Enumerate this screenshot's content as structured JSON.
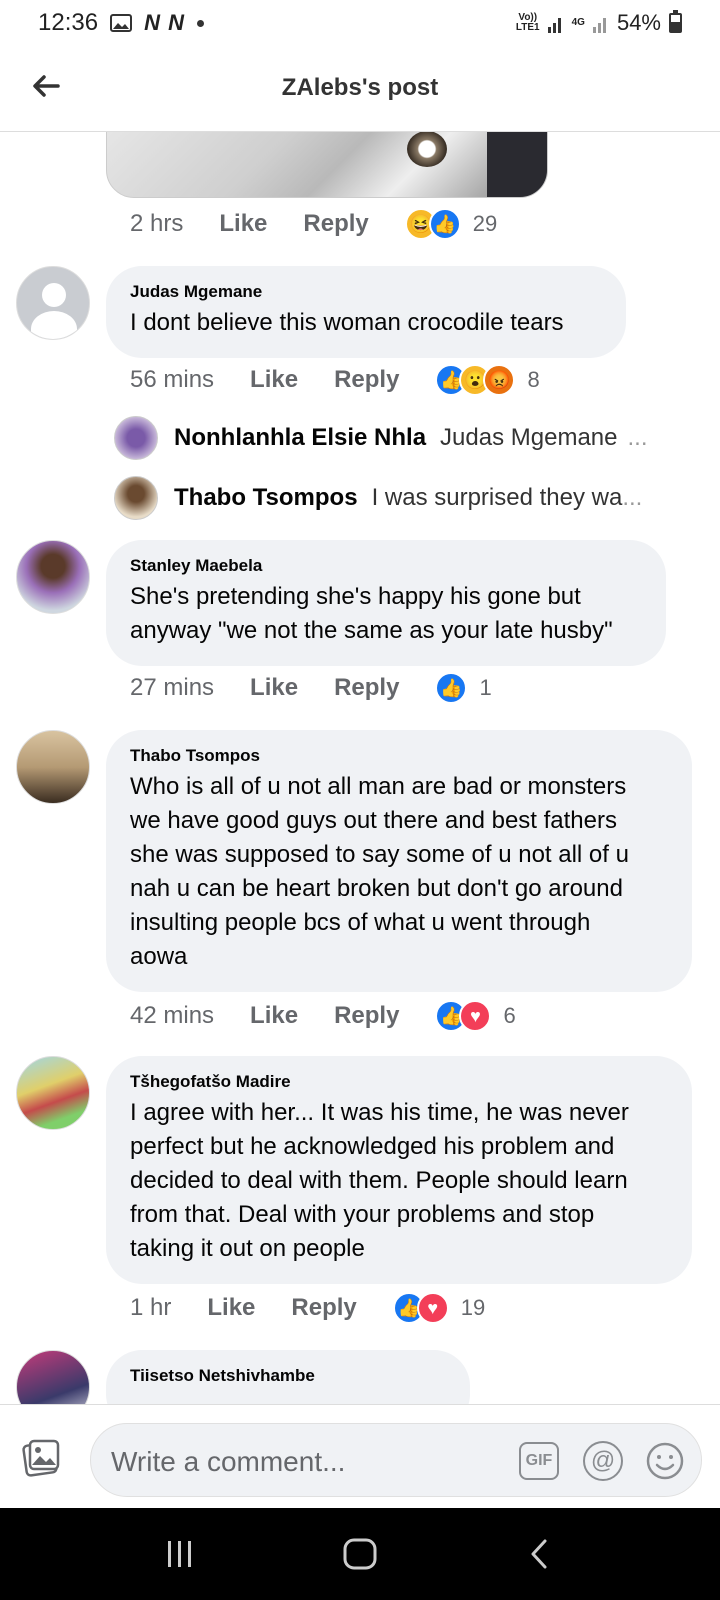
{
  "status_bar": {
    "time": "12:36",
    "notif_icons": [
      "image-icon",
      "news-icon",
      "news-icon"
    ],
    "nn_label": "N N",
    "net1": "Vo))",
    "net1_sub": "LTE1",
    "net2": "4G",
    "battery": "54%",
    "battery_level": 0.54
  },
  "header": {
    "title": "ZAlebs's post",
    "back_icon": "arrow-left-icon"
  },
  "first_meta": {
    "time": "2 hrs",
    "like": "Like",
    "reply": "Reply",
    "reactions": [
      "haha",
      "like"
    ],
    "count": "29"
  },
  "comments": [
    {
      "author": "Judas Mgemane",
      "text": "I dont believe this woman crocodile tears",
      "time": "56 mins",
      "like": "Like",
      "reply": "Reply",
      "reactions": [
        "like",
        "wow",
        "angry"
      ],
      "count": "8"
    },
    {
      "author": "Stanley Maebela",
      "text_lines": [
        "She's pretending she's happy his gone but",
        "anyway \"we not the same as your late husby\""
      ],
      "time": "27 mins",
      "like": "Like",
      "reply": "Reply",
      "reactions": [
        "like"
      ],
      "count": "1"
    },
    {
      "author": "Thabo Tsompos",
      "text_lines": [
        "Who is all of u not all man are bad or monsters",
        "we have good guys out there and best fathers",
        "she was supposed to say some of u not all of u",
        "nah u can be heart broken but don't go around",
        "insulting people bcs of what u went through",
        "aowa"
      ],
      "time": "42 mins",
      "like": "Like",
      "reply": "Reply",
      "reactions": [
        "like",
        "love"
      ],
      "count": "6"
    },
    {
      "author": "Tšhegofatšo Madire",
      "text_lines": [
        "I agree with her... It was his time, he was never",
        "perfect but he acknowledged his problem and",
        "decided to deal with them. People should learn",
        "from that. Deal with your problems and stop",
        "taking it out on people"
      ],
      "time": "1 hr",
      "like": "Like",
      "reply": "Reply",
      "reactions": [
        "like",
        "love"
      ],
      "count": "19"
    },
    {
      "author": "Tiisetso Netshivhambe"
    }
  ],
  "replies": [
    {
      "name": "Nonhlanhla Elsie Nhla",
      "text": "Judas Mgemane",
      "ellipsis": "..."
    },
    {
      "name": "Thabo Tsompos",
      "text": "I was surprised they wa",
      "ellipsis": "..."
    }
  ],
  "composer": {
    "placeholder": "Write a comment...",
    "gif": "GIF",
    "at": "@"
  },
  "colors": {
    "facebook_blue": "#1877f2",
    "bubble_bg": "#f0f2f5",
    "meta_gray": "#65676b"
  }
}
